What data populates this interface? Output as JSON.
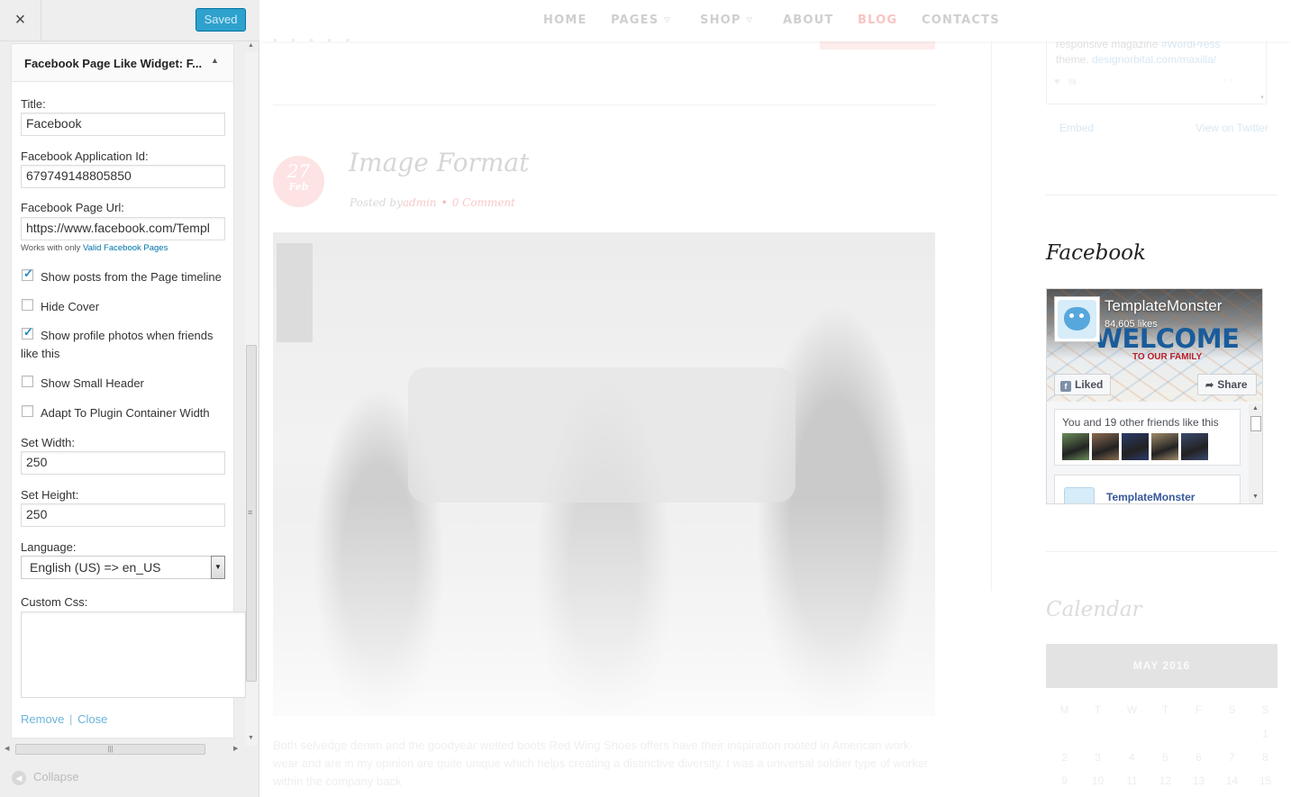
{
  "customizer": {
    "close_glyph": "×",
    "saved_label": "Saved",
    "widget_title": "Facebook Page Like Widget: F...",
    "collapse_label": "Collapse",
    "fields": {
      "title_label": "Title:",
      "title_value": "Facebook",
      "app_id_label": "Facebook Application Id:",
      "app_id_value": "679749148805850",
      "page_url_label": "Facebook Page Url:",
      "page_url_value": "https://www.facebook.com/Templ",
      "hint_prefix": "Works with only",
      "hint_link": "Valid Facebook Pages",
      "width_label": "Set Width:",
      "width_value": "250",
      "height_label": "Set Height:",
      "height_value": "250",
      "language_label": "Language:",
      "language_value": "English (US) => en_US",
      "custom_css_label": "Custom Css:"
    },
    "checkboxes": [
      {
        "label": "Show posts from the Page timeline",
        "checked": true
      },
      {
        "label": "Hide Cover",
        "checked": false
      },
      {
        "label": "Show profile photos when friends",
        "label_cont": "like this",
        "checked": true
      },
      {
        "label": "Show Small Header",
        "checked": false
      },
      {
        "label": "Adapt To Plugin Container Width",
        "checked": false
      }
    ],
    "actions": {
      "remove": "Remove",
      "separator": "|",
      "close": "Close"
    }
  },
  "site": {
    "nav": [
      {
        "label": "HOME",
        "active": false,
        "dropdown": false
      },
      {
        "label": "PAGES",
        "active": false,
        "dropdown": true
      },
      {
        "label": "SHOP",
        "active": false,
        "dropdown": true
      },
      {
        "label": "ABOUT",
        "active": false,
        "dropdown": false
      },
      {
        "label": "BLOG",
        "active": true,
        "dropdown": false
      },
      {
        "label": "CONTACTS",
        "active": false,
        "dropdown": false
      }
    ],
    "accent_color": "#f7a8a8",
    "post": {
      "date_day": "27",
      "date_month": "Feb",
      "title": "Image Format",
      "posted_by": "Posted by",
      "author": "admin",
      "comments": "0 Comment",
      "excerpt": "Both selvedge denim and the goodyear welted boots Red Wing Shoes offers have their inspiration rooted in American work-wear and are in my opinion are quite unique which helps creating a distinctive diversity. I was a universal soldier type of worker within the company back"
    },
    "twitter": {
      "text_line1": "responsive magazine",
      "text_hashtag": "#WordPress",
      "text_line2": "theme.",
      "text_link": "designorbital.com/maxilla/",
      "embed": "Embed",
      "view": "View on Twitter"
    },
    "facebook": {
      "heading": "Facebook",
      "page_name": "TemplateMonster",
      "likes": "84,605 likes",
      "welcome": "WELCOME",
      "to_our_family": "TO OUR FAMILY",
      "liked_label": "Liked",
      "share_label": "Share",
      "friends_text": "You and 19 other friends like this",
      "post_author": "TemplateMonster",
      "avatar_colors": [
        "#6b8c5a",
        "#8a6a4e",
        "#2b3a6a",
        "#a08a6a",
        "#3a4a6e"
      ]
    },
    "calendar": {
      "heading": "Calendar",
      "month": "MAY 2016",
      "weekdays": [
        "M",
        "T",
        "W",
        "T",
        "F",
        "S",
        "S"
      ],
      "rows": [
        [
          "",
          "",
          "",
          "",
          "",
          "",
          "1"
        ],
        [
          "2",
          "3",
          "4",
          "5",
          "6",
          "7",
          "8"
        ],
        [
          "9",
          "10",
          "11",
          "12",
          "13",
          "14",
          "15"
        ]
      ]
    }
  }
}
